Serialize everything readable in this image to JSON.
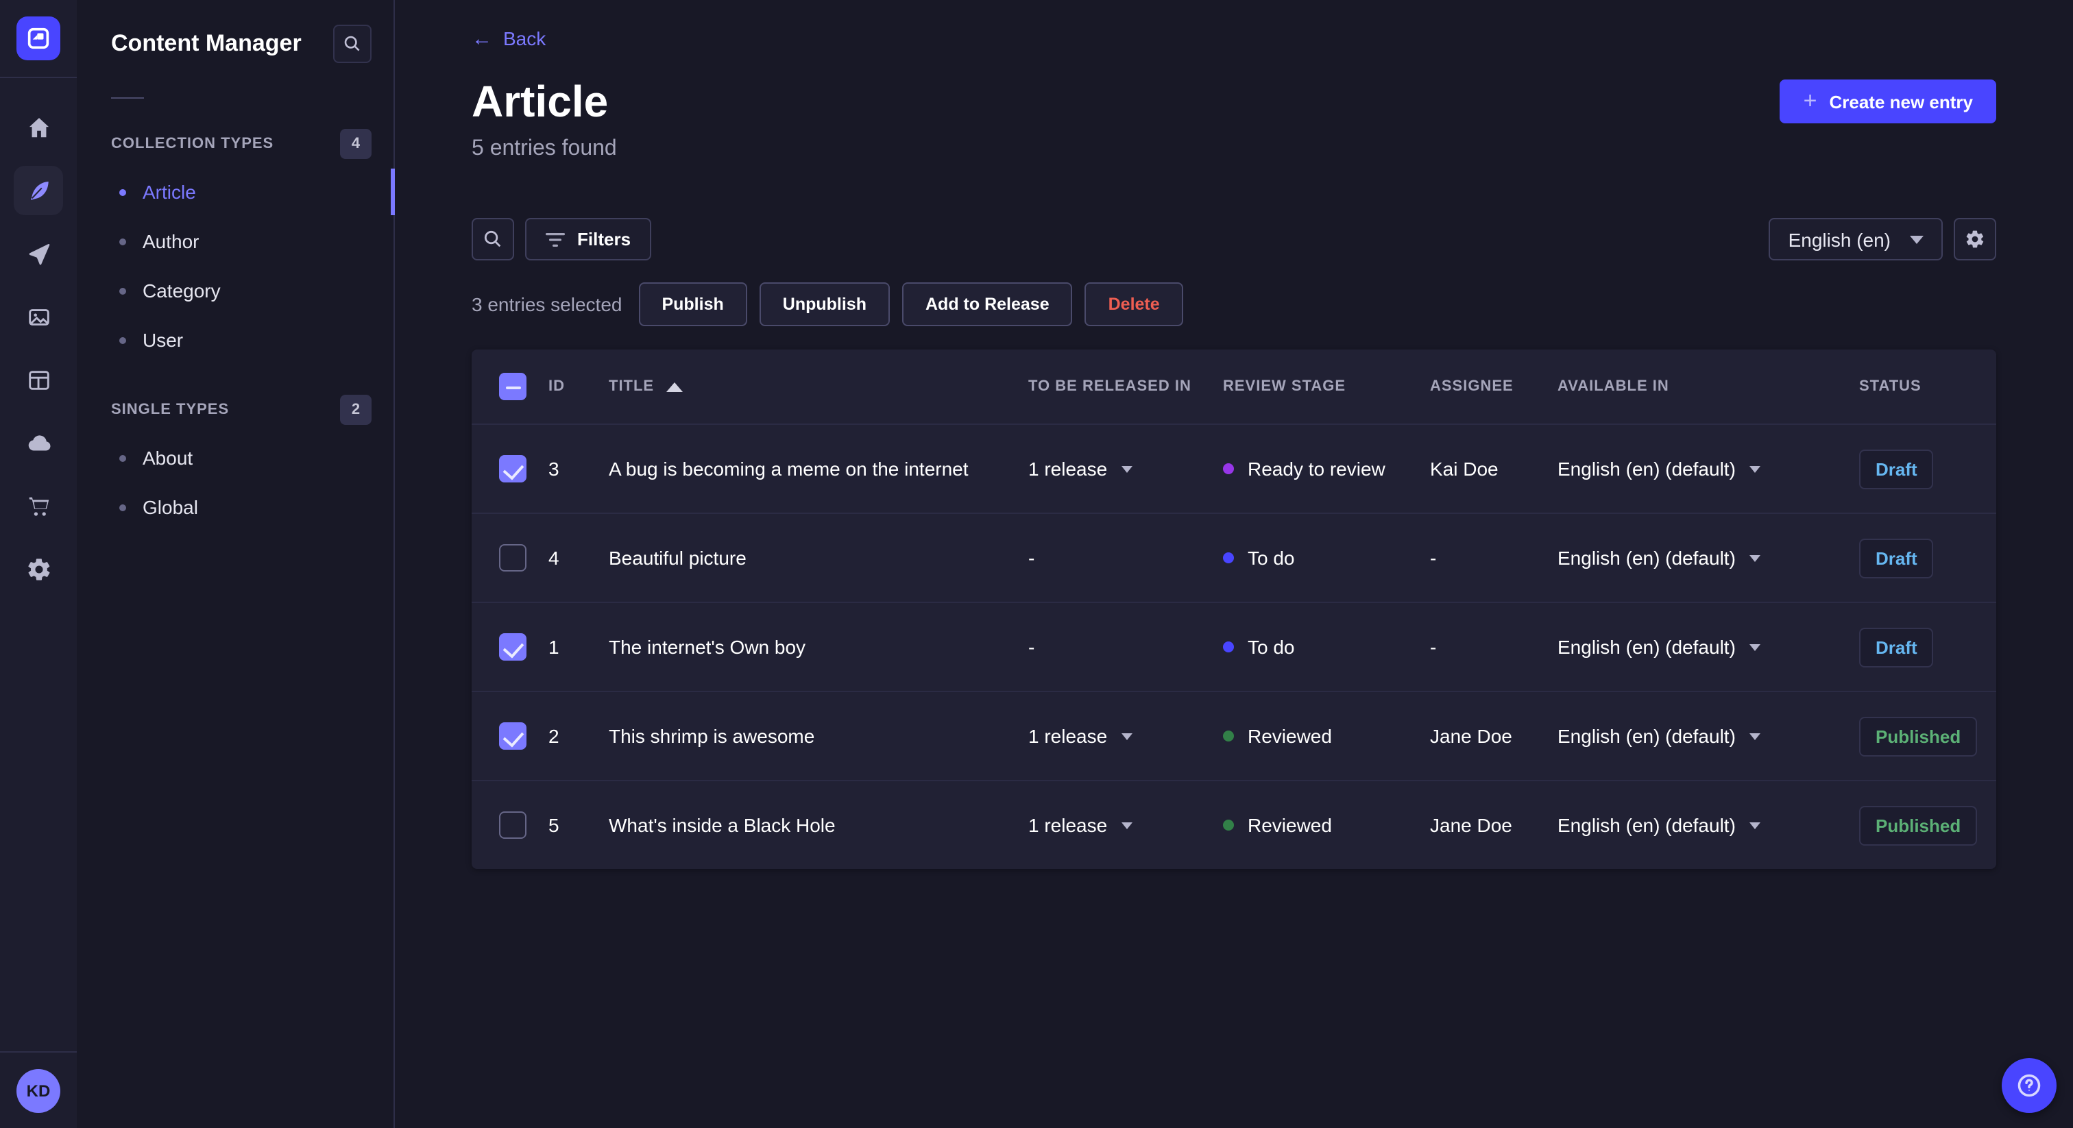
{
  "colors": {
    "primary": "#4945ff",
    "primary_light": "#7b79ff",
    "page_bg": "#181826",
    "card_bg": "#212134",
    "border": "#32324d",
    "muted_text": "#a5a5ba",
    "danger": "#ee5e52",
    "draft_text": "#66b7f1",
    "published_text": "#5cb176"
  },
  "rail": {
    "icons": [
      "strapi-logo-icon",
      "home-icon",
      "feather-icon",
      "paper-plane-icon",
      "media-images-icon",
      "layout-icon",
      "cloud-icon",
      "cart-icon",
      "gear-icon"
    ],
    "active_icon": "feather-icon",
    "avatar_initials": "KD"
  },
  "subnav": {
    "title": "Content Manager",
    "search_icon": "search-icon",
    "sections": [
      {
        "label": "COLLECTION TYPES",
        "count": "4",
        "items": [
          {
            "label": "Article",
            "active": true
          },
          {
            "label": "Author",
            "active": false
          },
          {
            "label": "Category",
            "active": false
          },
          {
            "label": "User",
            "active": false
          }
        ]
      },
      {
        "label": "SINGLE TYPES",
        "count": "2",
        "items": [
          {
            "label": "About",
            "active": false
          },
          {
            "label": "Global",
            "active": false
          }
        ]
      }
    ]
  },
  "header": {
    "back_label": "Back",
    "title": "Article",
    "subtitle": "5 entries found",
    "create_button_label": "Create new entry",
    "plus_glyph": "+"
  },
  "toolbar": {
    "filters_label": "Filters",
    "locale_selected": "English (en)",
    "icons": [
      "search-icon",
      "filter-icon",
      "chevron-down-icon",
      "gear-icon"
    ]
  },
  "selection": {
    "text": "3 entries selected",
    "publish_label": "Publish",
    "unpublish_label": "Unpublish",
    "add_to_release_label": "Add to Release",
    "delete_label": "Delete"
  },
  "table": {
    "headers": {
      "id": "ID",
      "title": "TITLE",
      "to_be_released_in": "TO BE RELEASED IN",
      "review_stage": "REVIEW STAGE",
      "assignee": "ASSIGNEE",
      "available_in": "AVAILABLE IN",
      "status": "STATUS"
    },
    "sort": {
      "column": "TITLE",
      "direction": "ascending"
    },
    "header_checkbox_state": "indeterminate",
    "rows": [
      {
        "selected": true,
        "id": "3",
        "title": "A bug is becoming a meme on the internet",
        "to_be_released_in": "1 release",
        "review_stage": "Ready to review",
        "review_stage_color": "#9736e8",
        "assignee": "Kai Doe",
        "available_in": "English (en) (default)",
        "status": "Draft"
      },
      {
        "selected": false,
        "id": "4",
        "title": "Beautiful picture",
        "to_be_released_in": "-",
        "review_stage": "To do",
        "review_stage_color": "#4945ff",
        "assignee": "-",
        "available_in": "English (en) (default)",
        "status": "Draft"
      },
      {
        "selected": true,
        "id": "1",
        "title": "The internet's Own boy",
        "to_be_released_in": "-",
        "review_stage": "To do",
        "review_stage_color": "#4945ff",
        "assignee": "-",
        "available_in": "English (en) (default)",
        "status": "Draft"
      },
      {
        "selected": true,
        "id": "2",
        "title": "This shrimp is awesome",
        "to_be_released_in": "1 release",
        "review_stage": "Reviewed",
        "review_stage_color": "#328048",
        "assignee": "Jane Doe",
        "available_in": "English (en) (default)",
        "status": "Published"
      },
      {
        "selected": false,
        "id": "5",
        "title": "What's inside a Black Hole",
        "to_be_released_in": "1 release",
        "review_stage": "Reviewed",
        "review_stage_color": "#328048",
        "assignee": "Jane Doe",
        "available_in": "English (en) (default)",
        "status": "Published"
      }
    ]
  },
  "help": {
    "icon": "question-mark-icon"
  }
}
